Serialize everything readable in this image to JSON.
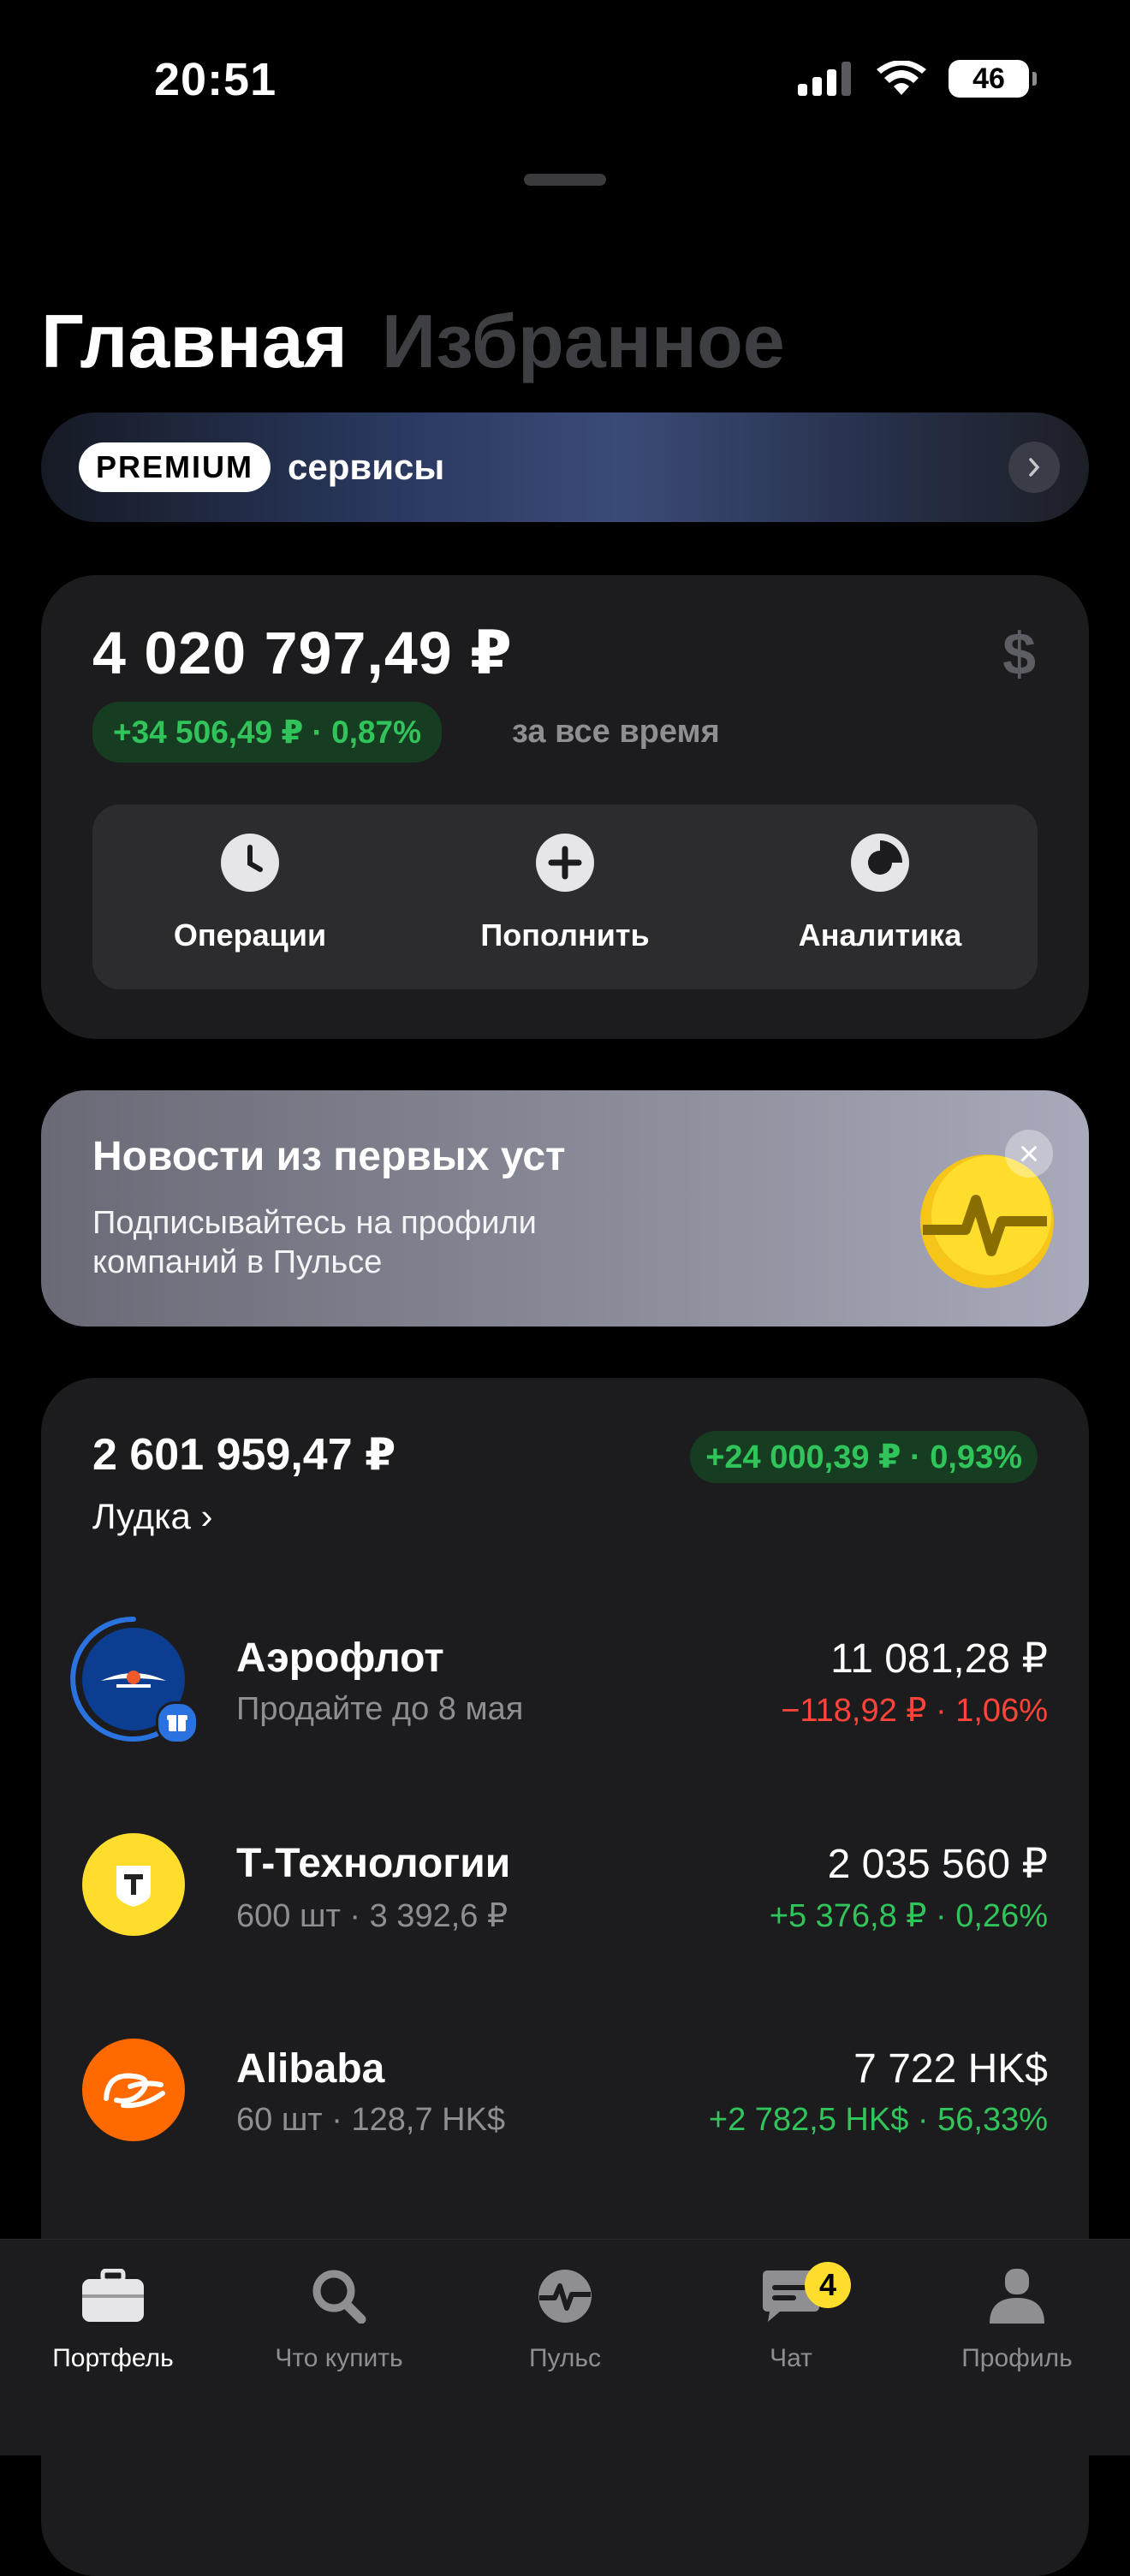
{
  "status_bar": {
    "time": "20:51",
    "battery": "46"
  },
  "tabs": {
    "active": "Главная",
    "inactive": "Избранное"
  },
  "premium": {
    "badge": "PREMIUM",
    "text": "сервисы"
  },
  "balance": {
    "total": "4 020 797,49 ₽",
    "change": "+34 506,49 ₽ · 0,87%",
    "period": "за все время",
    "currency_toggle": "$",
    "actions": [
      {
        "label": "Операции",
        "icon": "clock-icon"
      },
      {
        "label": "Пополнить",
        "icon": "plus-icon"
      },
      {
        "label": "Аналитика",
        "icon": "donut-chart-icon"
      }
    ]
  },
  "news": {
    "title": "Новости из первых уст",
    "subtitle": "Подписывайтесь на профили компаний в Пульсе",
    "close": "×"
  },
  "portfolio": {
    "total": "2 601 959,47 ₽",
    "change": "+24 000,39 ₽ · 0,93%",
    "name": "Лудка ›",
    "items": [
      {
        "name": "Аэрофлот",
        "sub": "Продайте до 8 мая",
        "value": "11 081,28 ₽",
        "change": "−118,92 ₽ · 1,06%",
        "trend": "down",
        "logo_color": "#0b3d91"
      },
      {
        "name": "Т-Технологии",
        "sub": "600 шт · 3 392,6 ₽",
        "value": "2 035 560 ₽",
        "change": "+5 376,8 ₽ · 0,26%",
        "trend": "up",
        "logo_color": "#ffdd2d"
      },
      {
        "name": "Alibaba",
        "sub": "60 шт · 128,7 HK$",
        "value": "7 722 HK$",
        "change": "+2 782,5 HK$ · 56,33%",
        "trend": "up",
        "logo_color": "#ff6a00"
      }
    ]
  },
  "tabbar": {
    "items": [
      {
        "label": "Портфель",
        "icon": "briefcase-icon",
        "active": true
      },
      {
        "label": "Что купить",
        "icon": "search-icon",
        "active": false
      },
      {
        "label": "Пульс",
        "icon": "pulse-icon",
        "active": false
      },
      {
        "label": "Чат",
        "icon": "chat-icon",
        "active": false,
        "badge": "4"
      },
      {
        "label": "Профиль",
        "icon": "profile-icon",
        "active": false
      }
    ]
  }
}
